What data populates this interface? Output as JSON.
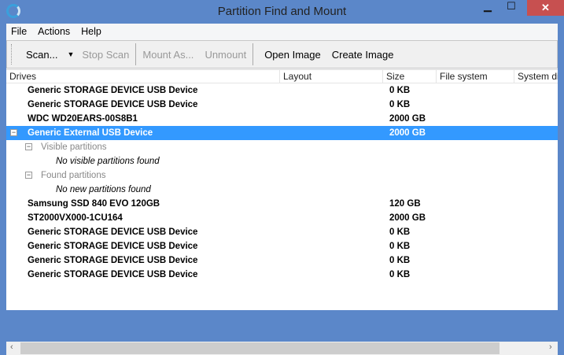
{
  "window": {
    "title": "Partition Find and Mount",
    "minimize": "▁",
    "maximize": "☐",
    "close": "✕"
  },
  "menu": [
    "File",
    "Actions",
    "Help"
  ],
  "toolbar": {
    "scan": "Scan...",
    "stop_scan": "Stop Scan",
    "mount_as": "Mount As...",
    "unmount": "Unmount",
    "open_image": "Open Image",
    "create_image": "Create Image"
  },
  "columns": [
    "Drives",
    "Layout",
    "Size",
    "File system",
    "System disk"
  ],
  "rows": [
    {
      "name": "Generic STORAGE DEVICE USB Device",
      "size": "0 KB"
    },
    {
      "name": "Generic STORAGE DEVICE USB Device",
      "size": "0 KB"
    },
    {
      "name": "WDC WD20EARS-00S8B1",
      "size": "2000 GB"
    },
    {
      "name": "Generic External USB Device",
      "size": "2000 GB",
      "selected": true,
      "expanded": true
    },
    {
      "group": "Visible partitions",
      "message": "No visible partitions found"
    },
    {
      "group": "Found partitions",
      "message": "No new partitions found"
    },
    {
      "name": "Samsung SSD 840 EVO 120GB",
      "size": "120 GB"
    },
    {
      "name": "ST2000VX000-1CU164",
      "size": "2000 GB"
    },
    {
      "name": "Generic STORAGE DEVICE USB Device",
      "size": "0 KB"
    },
    {
      "name": "Generic STORAGE DEVICE USB Device",
      "size": "0 KB"
    },
    {
      "name": "Generic STORAGE DEVICE USB Device",
      "size": "0 KB"
    },
    {
      "name": "Generic STORAGE DEVICE USB Device",
      "size": "0 KB"
    }
  ],
  "scrollbar": {
    "left": "‹",
    "right": "›"
  }
}
